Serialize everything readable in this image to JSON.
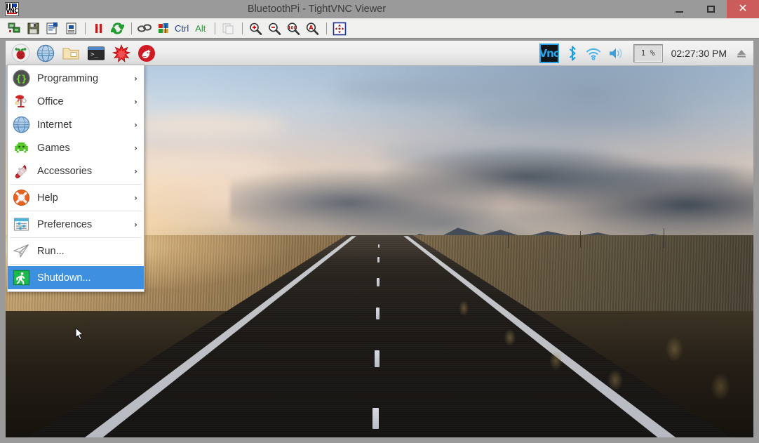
{
  "window": {
    "title": "BluetoothPi - TightVNC Viewer",
    "icon": "vnc-logo-icon",
    "icon_word": "VNC",
    "controls": {
      "minimize_label": "–",
      "maximize_label": "☐",
      "close_label": "✕"
    },
    "colors": {
      "titlebar_bg": "#9a9a9a",
      "close_bg": "#cc5b5b",
      "toolbar_bg": "#f0f0ef",
      "border": "#9a9a9a"
    }
  },
  "vnc_toolbar": {
    "buttons": [
      {
        "name": "new-connection-icon",
        "tooltip": "New connection"
      },
      {
        "name": "save-session-icon",
        "tooltip": "Save session"
      },
      {
        "name": "connection-options-icon",
        "tooltip": "Connection options"
      },
      {
        "name": "connection-info-icon",
        "tooltip": "Connection info"
      },
      {
        "name": "pause-icon",
        "tooltip": "Pause"
      },
      {
        "name": "refresh-icon",
        "tooltip": "Request screen refresh"
      },
      {
        "name": "send-ctrl-alt-del-icon",
        "tooltip": "Send Ctrl-Alt-Del"
      },
      {
        "name": "send-keys-icon",
        "tooltip": "Send keys"
      },
      {
        "name": "ctrl-key-label",
        "tooltip": "Ctrl"
      },
      {
        "name": "alt-key-label",
        "tooltip": "Alt"
      },
      {
        "name": "clipboard-transfer-icon",
        "tooltip": "Transfer clipboard"
      },
      {
        "name": "zoom-in-icon",
        "tooltip": "Zoom in"
      },
      {
        "name": "zoom-out-icon",
        "tooltip": "Zoom out"
      },
      {
        "name": "zoom-100-icon",
        "tooltip": "Zoom 100%"
      },
      {
        "name": "zoom-auto-icon",
        "tooltip": "Auto scaling"
      },
      {
        "name": "fullscreen-icon",
        "tooltip": "Full screen"
      }
    ],
    "ctrl_label": "Ctrl",
    "alt_label": "Alt",
    "zoom_100_label": "100"
  },
  "taskbar": {
    "launchers": [
      {
        "name": "menu-button-raspberry-icon",
        "label": "Menu"
      },
      {
        "name": "web-browser-icon",
        "label": "Web Browser"
      },
      {
        "name": "file-manager-icon",
        "label": "File Manager"
      },
      {
        "name": "terminal-icon",
        "label": "Terminal"
      },
      {
        "name": "mathematica-icon",
        "label": "Mathematica"
      },
      {
        "name": "wolfram-icon",
        "label": "Wolfram"
      }
    ],
    "systray": {
      "vnc_label": "Vnc",
      "bluetooth_label": "Bluetooth",
      "wifi_label": "Wireless Network",
      "volume_label": "Volume",
      "cpu_value": "1 %",
      "clock": "02:27:30 PM",
      "eject_label": "Eject"
    }
  },
  "start_menu": {
    "items": [
      {
        "label": "Programming",
        "icon": "programming-braces-icon",
        "has_submenu": true,
        "selected": false
      },
      {
        "label": "Office",
        "icon": "office-lamp-icon",
        "has_submenu": true,
        "selected": false
      },
      {
        "label": "Internet",
        "icon": "internet-globe-icon",
        "has_submenu": true,
        "selected": false
      },
      {
        "label": "Games",
        "icon": "games-invader-icon",
        "has_submenu": true,
        "selected": false
      },
      {
        "label": "Accessories",
        "icon": "accessories-knife-icon",
        "has_submenu": true,
        "selected": false
      },
      {
        "label": "Help",
        "icon": "help-lifering-icon",
        "has_submenu": true,
        "selected": false
      },
      {
        "label": "Preferences",
        "icon": "preferences-sliders-icon",
        "has_submenu": true,
        "selected": false
      },
      {
        "label": "Run...",
        "icon": "run-paperplane-icon",
        "has_submenu": false,
        "selected": false
      },
      {
        "label": "Shutdown...",
        "icon": "shutdown-exit-icon",
        "has_submenu": false,
        "selected": true
      }
    ],
    "arrow_glyph": "›",
    "highlight_color": "#3d8fe0"
  },
  "desktop": {
    "wallpaper_description": "Straight asphalt road through golden fields toward mountains at sunset"
  }
}
